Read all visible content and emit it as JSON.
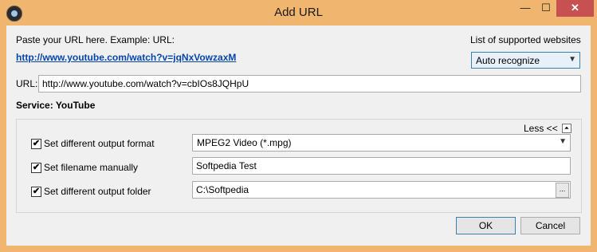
{
  "window": {
    "title": "Add URL",
    "minimize_glyph": "—",
    "maximize_glyph": "☐",
    "close_glyph": "✕"
  },
  "paste_hint": "Paste your URL here. Example: URL:",
  "example_url": "http://www.youtube.com/watch?v=jqNxVowzaxM",
  "supported_sites_label": "List of supported websites",
  "site_select": {
    "value": "Auto recognize",
    "arrow": "▼"
  },
  "url_label": "URL:",
  "url_value": "http://www.youtube.com/watch?v=cbIOs8JQHpU",
  "service_label": "Service: YouTube",
  "less_label": "Less <<",
  "collapse_glyph": "⏶",
  "options": {
    "format": {
      "label": "Set different output format",
      "checked": true,
      "value": "MPEG2 Video (*.mpg)",
      "arrow": "▼"
    },
    "filename": {
      "label": "Set filename manually",
      "checked": true,
      "value": "Softpedia Test"
    },
    "folder": {
      "label": "Set different output folder",
      "checked": true,
      "value": "C:\\Softpedia",
      "browse": "..."
    }
  },
  "checkmark": "✔",
  "buttons": {
    "ok": "OK",
    "cancel": "Cancel"
  },
  "colors": {
    "frame": "#f0b56e",
    "client": "#f0f0f0",
    "link": "#0645ad",
    "close": "#c75050"
  }
}
